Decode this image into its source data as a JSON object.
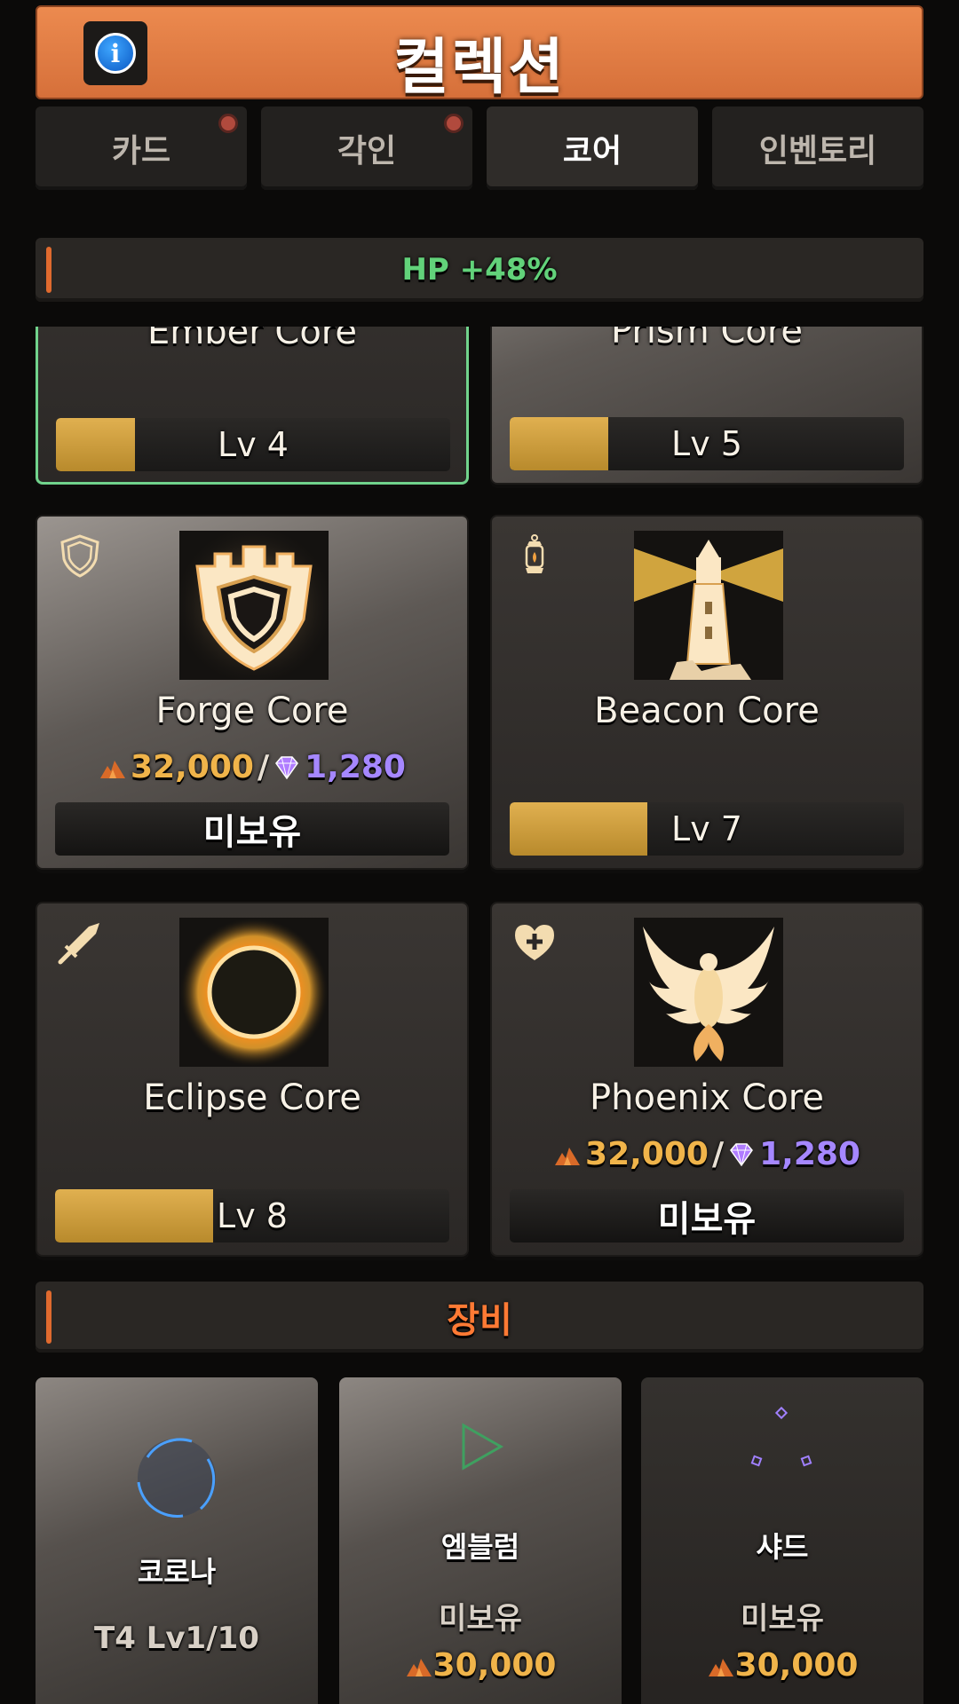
{
  "header": {
    "title": "컬렉션",
    "info_icon": "i"
  },
  "tabs": [
    {
      "label": "카드",
      "badge": true
    },
    {
      "label": "각인",
      "badge": true
    },
    {
      "label": "코어",
      "badge": false,
      "active": true
    },
    {
      "label": "인벤토리",
      "badge": false
    }
  ],
  "bonus": {
    "text": "HP +48%"
  },
  "cores": [
    {
      "name": "Ember Core",
      "level": "Lv 4",
      "progress": 0.2
    },
    {
      "name": "Prism Core",
      "level": "Lv 5",
      "progress": 0.25
    },
    {
      "name": "Forge Core",
      "owned": false,
      "cost_gold": "32,000",
      "cost_sep": "/",
      "cost_gem": "1,280",
      "status": "미보유",
      "icon": "shield-icon"
    },
    {
      "name": "Beacon Core",
      "level": "Lv 7",
      "progress": 0.35,
      "icon": "lantern-icon"
    },
    {
      "name": "Eclipse Core",
      "level": "Lv 8",
      "progress": 0.4,
      "icon": "sword-icon"
    },
    {
      "name": "Phoenix Core",
      "owned": false,
      "cost_gold": "32,000",
      "cost_sep": "/",
      "cost_gem": "1,280",
      "status": "미보유",
      "icon": "heart-plus-icon"
    }
  ],
  "equipment": {
    "title": "장비",
    "items": [
      {
        "name": "코로나",
        "stat": "T4 Lv1/10"
      },
      {
        "name": "엠블럼",
        "status": "미보유",
        "price": "30,000"
      },
      {
        "name": "샤드",
        "status": "미보유",
        "price": "30,000"
      }
    ]
  },
  "colors": {
    "accent": "#e06a2e",
    "header": "#e07a40",
    "gold": "#f0b44a",
    "gem": "#a587ff",
    "bonus": "#62d27a",
    "selected": "#71d38c"
  }
}
